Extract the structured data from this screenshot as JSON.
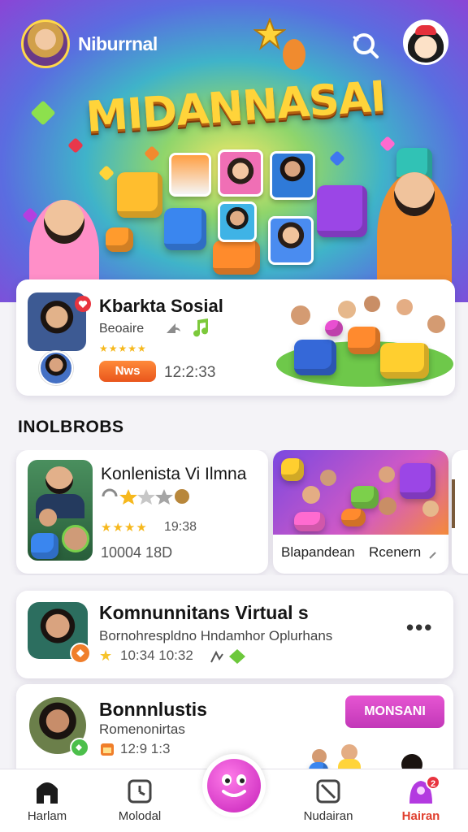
{
  "header": {
    "username": "Niburrnal",
    "banner_title": "MIDANNASAI"
  },
  "featured": {
    "title": "Kbarkta Sosial",
    "subtitle": "Beoaire",
    "stars": "★★★★★",
    "badge": "Nws",
    "time": "12:2:33"
  },
  "section": {
    "heading": "INOLBROBS"
  },
  "carousel": [
    {
      "title": "Konlenista Vi Ilmna",
      "stars": "★★★★",
      "time": "19:38",
      "extra": "10004 18D"
    },
    {
      "caption_left": "Blapandean",
      "caption_right": "Rcenern"
    }
  ],
  "list": [
    {
      "title": "Komnunnitans Virtual s",
      "subtitle": "Bornohrespldno Hndamhor Oplurhans",
      "time": "10:34 10:32",
      "more": "•••"
    },
    {
      "title": "Bonnnlustis",
      "subtitle": "Romenonirtas",
      "time": "12:9 1:3",
      "button": "MONSANI"
    }
  ],
  "nav": {
    "items": [
      {
        "label": "Harlam"
      },
      {
        "label": "Molodal"
      },
      {
        "label": "Nudairan"
      },
      {
        "label": "Hairan"
      }
    ],
    "notification_count": "2",
    "active_color": "#e0402f"
  },
  "colors": {
    "accent_pink": "#c238b8",
    "accent_orange": "#e9561c",
    "star": "#f6b81d"
  }
}
